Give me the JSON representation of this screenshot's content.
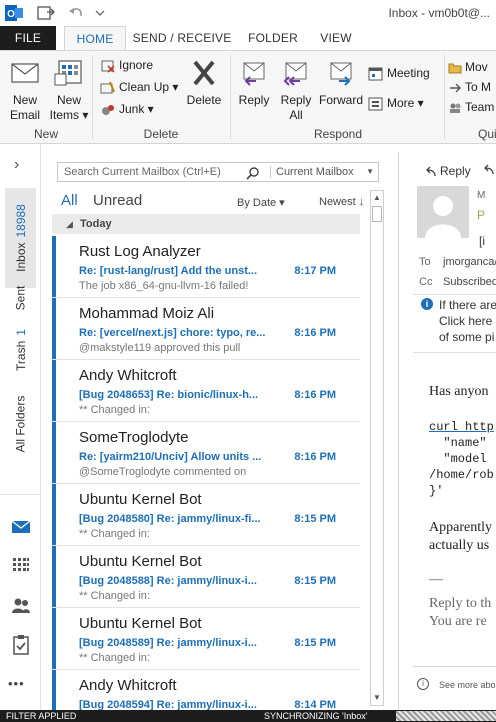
{
  "window": {
    "title": "Inbox - vm0b0t@...",
    "quick_access": [
      "outlook-icon",
      "send-receive-icon",
      "undo-icon",
      "customize-icon"
    ]
  },
  "tabs": [
    {
      "label": "FILE"
    },
    {
      "label": "HOME",
      "active": true
    },
    {
      "label": "SEND / RECEIVE"
    },
    {
      "label": "FOLDER"
    },
    {
      "label": "VIEW"
    }
  ],
  "ribbon": {
    "new_email": "New Email",
    "new_email_l1": "New",
    "new_email_l2": "Email",
    "new_items_l1": "New",
    "new_items_l2": "Items ▾",
    "group_new": "New",
    "ignore": "Ignore",
    "cleanup": "Clean Up ▾",
    "junk": "Junk ▾",
    "delete": "Delete",
    "group_delete": "Delete",
    "reply": "Reply",
    "reply_all_l1": "Reply",
    "reply_all_l2": "All",
    "forward": "Forward",
    "meeting": "Meeting",
    "more": "More ▾",
    "group_respond": "Respond",
    "quick_move": "Mov",
    "quick_to": "To M",
    "quick_team": "Team",
    "group_quick": "Qui"
  },
  "leftnav": {
    "inbox": "Inbox",
    "inbox_count": "18988",
    "sent": "Sent",
    "trash": "Trash",
    "trash_count": "1",
    "all_folders": "All Folders",
    "collapse": "›",
    "more": "•••"
  },
  "list": {
    "search_placeholder": "Search Current Mailbox (Ctrl+E)",
    "search_scope": "Current Mailbox",
    "filter_all": "All",
    "filter_unread": "Unread",
    "sort_by": "By Date ▾",
    "sort_order": "Newest ↓",
    "group_today": "Today",
    "messages": [
      {
        "sender": "Rust Log Analyzer",
        "subject": "Re: [rust-lang/rust] Add the unst...",
        "time": "8:17 PM",
        "preview": "The job x86_64-gnu-llvm-16 failed!"
      },
      {
        "sender": "Mohammad Moiz Ali",
        "subject": "Re: [vercel/next.js] chore: typo, re...",
        "time": "8:16 PM",
        "preview": "@makstyle119 approved this pull"
      },
      {
        "sender": "Andy Whitcroft",
        "subject": "[Bug 2048653] Re: bionic/linux-h...",
        "time": "8:16 PM",
        "preview": "** Changed in:"
      },
      {
        "sender": "SomeTroglodyte",
        "subject": "Re: [yairm210/Unciv] Allow units ...",
        "time": "8:16 PM",
        "preview": "@SomeTroglodyte commented on"
      },
      {
        "sender": "Ubuntu Kernel Bot",
        "subject": "[Bug 2048580] Re: jammy/linux-fi...",
        "time": "8:15 PM",
        "preview": "** Changed in:"
      },
      {
        "sender": "Ubuntu Kernel Bot",
        "subject": "[Bug 2048588] Re: jammy/linux-i...",
        "time": "8:15 PM",
        "preview": "** Changed in:"
      },
      {
        "sender": "Ubuntu Kernel Bot",
        "subject": "[Bug 2048589] Re: jammy/linux-i...",
        "time": "8:15 PM",
        "preview": "** Changed in:"
      },
      {
        "sender": "Andy Whitcroft",
        "subject": "[Bug 2048594] Re: jammy/linux-i...",
        "time": "8:14 PM",
        "preview": ""
      }
    ]
  },
  "reading": {
    "reply": "Reply",
    "to_label": "To",
    "to_value": "jmorganca/",
    "cc_label": "Cc",
    "cc_value": "Subscribed",
    "info_l1": "If there are",
    "info_l2": "Click here t",
    "info_l3": "of some pi",
    "body_l1": "Has anyon",
    "code_l1": "curl http",
    "code_l2": "  \"name\"",
    "code_l3": "  \"model",
    "code_l4": "/home/rob",
    "code_l5": "}'",
    "body_l2": "Apparently",
    "body_l3": "actually us",
    "dash": "—",
    "body_l4": "Reply to th",
    "body_l5": "You are re",
    "see_more": "See more abou"
  },
  "status": {
    "filter": "FILTER APPLIED",
    "sync": "SYNCHRONIZING 'Inbox'"
  }
}
